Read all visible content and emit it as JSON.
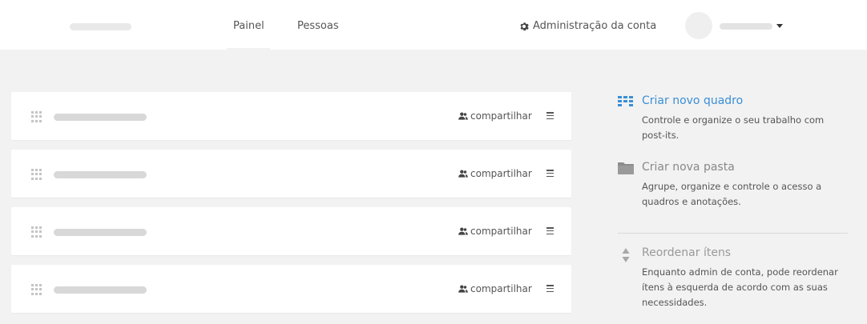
{
  "header": {
    "nav": [
      {
        "label": "Painel",
        "active": true
      },
      {
        "label": "Pessoas",
        "active": false
      }
    ],
    "admin_link": {
      "label": "Administração da conta",
      "icon": "gear-icon"
    },
    "user_menu": {
      "icon": "caret-down-icon"
    }
  },
  "boards": [
    {
      "share_label": "compartilhar",
      "share_icon": "users-icon",
      "menu_icon": "hamburger-icon",
      "drag_icon": "drag-grip-icon"
    },
    {
      "share_label": "compartilhar",
      "share_icon": "users-icon",
      "menu_icon": "hamburger-icon",
      "drag_icon": "drag-grip-icon"
    },
    {
      "share_label": "compartilhar",
      "share_icon": "users-icon",
      "menu_icon": "hamburger-icon",
      "drag_icon": "drag-grip-icon"
    },
    {
      "share_label": "compartilhar",
      "share_icon": "users-icon",
      "menu_icon": "hamburger-icon",
      "drag_icon": "drag-grip-icon"
    }
  ],
  "sidebar": {
    "new_board": {
      "title": "Criar novo quadro",
      "description": "Controle e organize o seu trabalho com post-its.",
      "icon": "board-icon",
      "color": "#3a8fd6"
    },
    "new_folder": {
      "title": "Criar nova pasta",
      "description": "Agrupe, organize e controle o acesso a quadros e anotações.",
      "icon": "folder-icon",
      "color": "#888888"
    },
    "reorder": {
      "title": "Reordenar ítens",
      "description": "Enquanto admin de conta, pode reordenar ítens à esquerda de acordo com as suas necessidades.",
      "icon": "sort-arrows-icon",
      "color": "#999999"
    }
  },
  "colors": {
    "page_background": "#f2f2f2",
    "card_background": "#ffffff",
    "accent": "#3a8fd6"
  }
}
